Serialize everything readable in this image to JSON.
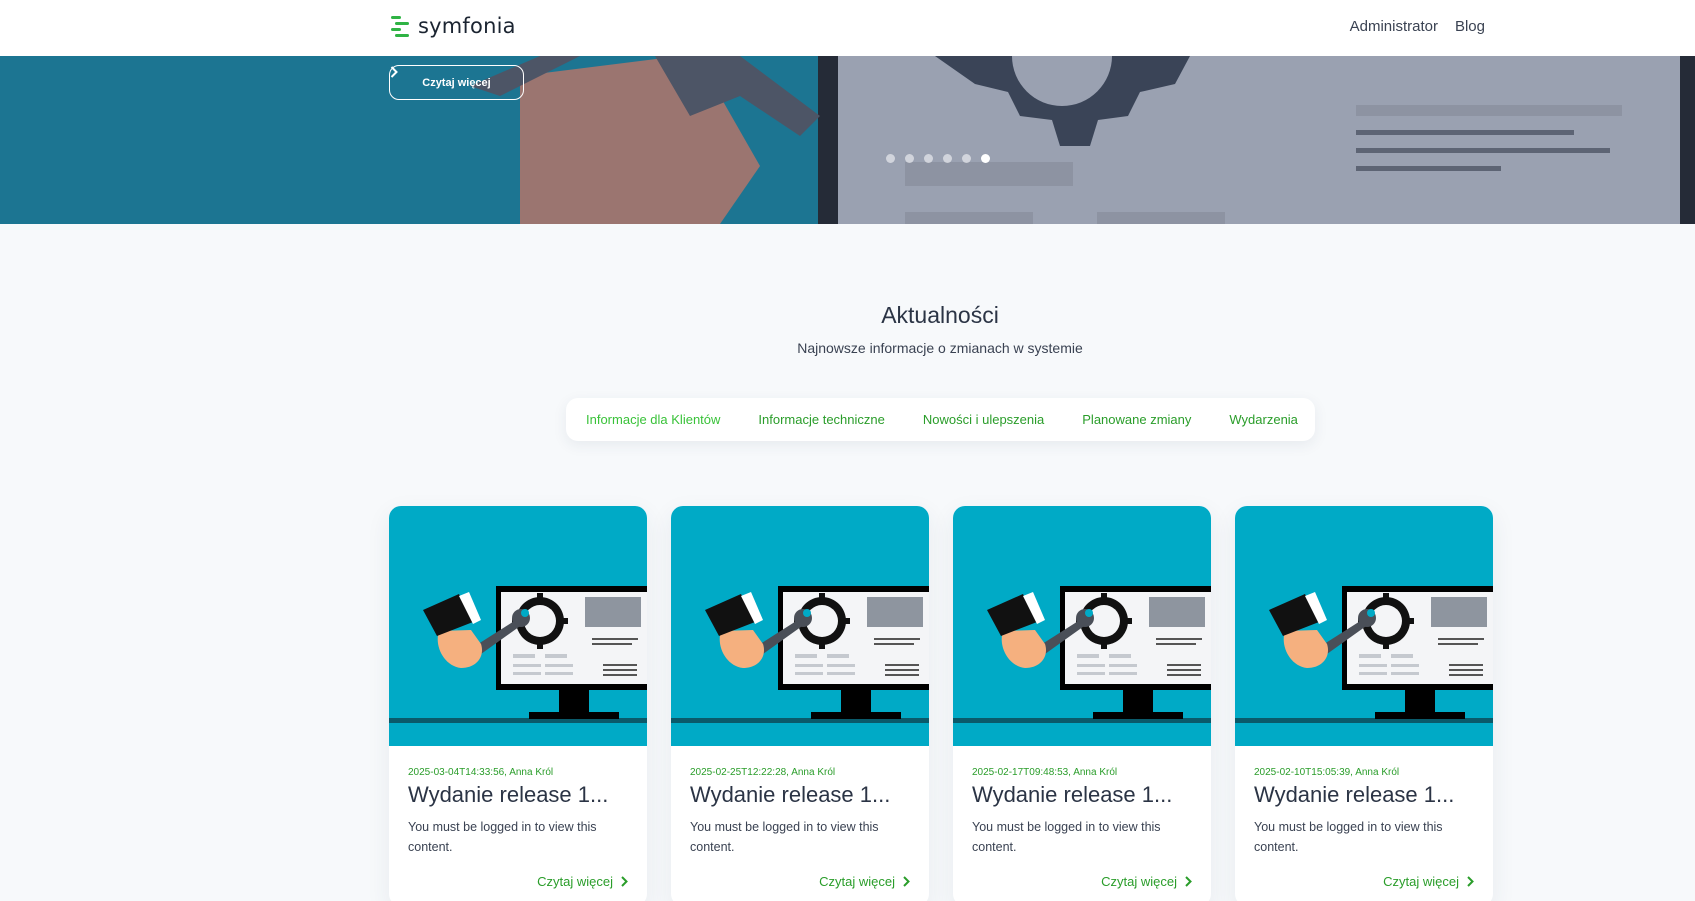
{
  "header": {
    "brand": "symfonia",
    "nav": [
      {
        "label": "Administrator"
      },
      {
        "label": "Blog"
      }
    ]
  },
  "hero": {
    "button_label": "Czytaj więcej",
    "slides_count": 6,
    "active_slide": 6
  },
  "news": {
    "title": "Aktualności",
    "subtitle": "Najnowsze informacje o zmianach w systemie",
    "tabs": [
      {
        "label": "Informacje dla Klientów",
        "active": true
      },
      {
        "label": "Informacje techniczne",
        "active": false
      },
      {
        "label": "Nowości i ulepszenia",
        "active": false
      },
      {
        "label": "Planowane zmiany",
        "active": false
      },
      {
        "label": "Wydarzenia",
        "active": false
      }
    ],
    "cards": [
      {
        "meta": "2025-03-04T14:33:56, Anna Król",
        "title": "Wydanie release 1...",
        "text": "You must be logged in to view this content.",
        "link": "Czytaj więcej"
      },
      {
        "meta": "2025-02-25T12:22:28, Anna Król",
        "title": "Wydanie release 1...",
        "text": "You must be logged in to view this content.",
        "link": "Czytaj więcej"
      },
      {
        "meta": "2025-02-17T09:48:53, Anna Król",
        "title": "Wydanie release 1...",
        "text": "You must be logged in to view this content.",
        "link": "Czytaj więcej"
      },
      {
        "meta": "2025-02-10T15:05:39, Anna Król",
        "title": "Wydanie release 1...",
        "text": "You must be logged in to view this content.",
        "link": "Czytaj więcej"
      }
    ]
  },
  "colors": {
    "accent_green": "#2fb344",
    "hero_bg": "#1c7592",
    "card_image_bg": "#00aac6"
  },
  "icons": [
    "chevron-right-icon",
    "wrench-icon",
    "gear-icon",
    "monitor-icon"
  ]
}
